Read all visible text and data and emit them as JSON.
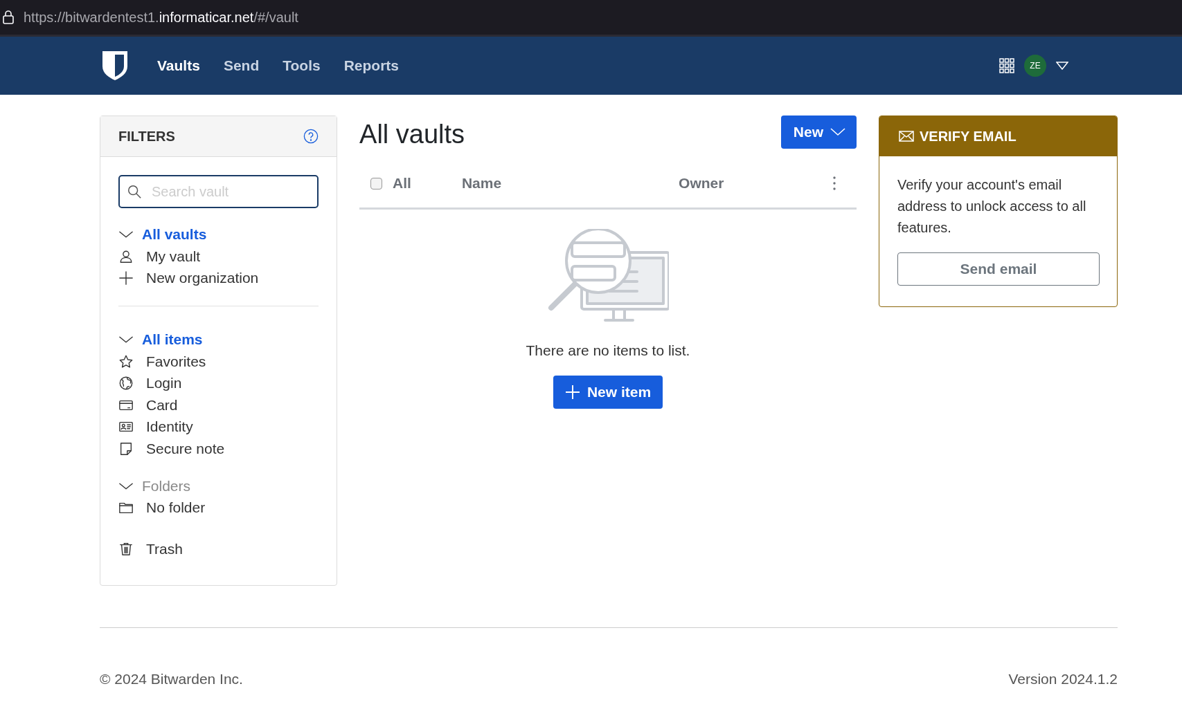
{
  "address_bar": {
    "url": [
      {
        "text": "https://bitwardentest1.",
        "highlighted": false
      },
      {
        "text": "informaticar.net",
        "highlighted": true
      },
      {
        "text": "/#/vault",
        "highlighted": false
      }
    ]
  },
  "nav": {
    "items": [
      {
        "label": "Vaults",
        "selected": true
      },
      {
        "label": "Send",
        "selected": false
      },
      {
        "label": "Tools",
        "selected": false
      },
      {
        "label": "Reports",
        "selected": false
      }
    ],
    "avatar": "ZE"
  },
  "filters": {
    "title": "FILTERS",
    "search": {
      "placeholder": "Search vault"
    },
    "groups": [
      {
        "label": "All vaults",
        "selected": true,
        "items": [
          {
            "label": "My vault",
            "kind": "person"
          },
          {
            "label": "New organization",
            "kind": "plus"
          }
        ]
      },
      {
        "label": "All items",
        "selected": true,
        "items": [
          {
            "label": "Favorites",
            "kind": "star"
          },
          {
            "label": "Login",
            "kind": "globe"
          },
          {
            "label": "Card",
            "kind": "card"
          },
          {
            "label": "Identity",
            "kind": "id"
          },
          {
            "label": "Secure note",
            "kind": "note"
          }
        ]
      },
      {
        "label": "Folders",
        "selected": false,
        "items": [
          {
            "label": "No folder",
            "kind": "folder"
          }
        ]
      }
    ],
    "trash": {
      "label": "Trash",
      "kind": "trash"
    }
  },
  "main": {
    "title": "All vaults",
    "new_button": "New",
    "table": {
      "select_all": {
        "label": "All",
        "checked": false
      },
      "columns": [
        "Name",
        "Owner"
      ]
    },
    "empty_message": "There are no items to list.",
    "new_item_button": "New item"
  },
  "verify_email": {
    "title": "VERIFY EMAIL",
    "text": "Verify your account's email address to unlock access to all features.",
    "button": "Send email"
  },
  "footer": {
    "copyright": "© 2024 Bitwarden Inc.",
    "version": "Version 2024.1.2"
  }
}
